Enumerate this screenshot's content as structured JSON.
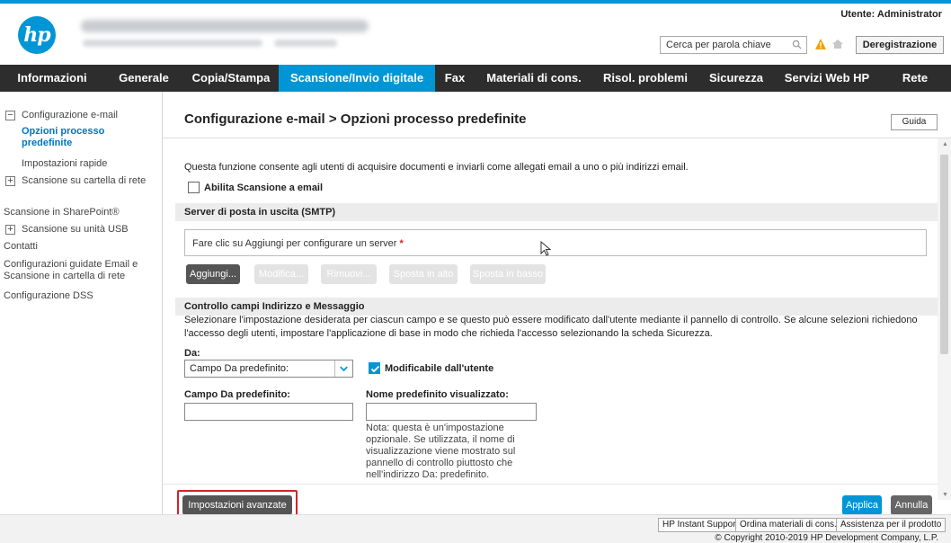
{
  "header": {
    "user_label": "Utente: Administrator",
    "search_placeholder": "Cerca per parola chiave",
    "logout_label": "Deregistrazione"
  },
  "nav": {
    "items": [
      {
        "label": "Informazioni"
      },
      {
        "label": "Generale"
      },
      {
        "label": "Copia/Stampa"
      },
      {
        "label": "Scansione/Invio digitale",
        "active": true
      },
      {
        "label": "Fax"
      },
      {
        "label": "Materiali di cons."
      },
      {
        "label": "Risol. problemi"
      },
      {
        "label": "Sicurezza"
      },
      {
        "label": "Servizi Web HP"
      },
      {
        "label": "Rete"
      }
    ]
  },
  "sidebar": {
    "items": [
      {
        "label": "Configurazione e-mail"
      },
      {
        "label": "Opzioni processo predefinite"
      },
      {
        "label": "Impostazioni rapide"
      },
      {
        "label": "Scansione su cartella di rete"
      },
      {
        "label": "Scansione in SharePoint®"
      },
      {
        "label": "Scansione su unità USB"
      },
      {
        "label": "Contatti"
      },
      {
        "label": "Configurazioni guidate Email e Scansione in cartella di rete"
      },
      {
        "label": "Configurazione DSS"
      }
    ]
  },
  "main": {
    "title": "Configurazione e-mail > Opzioni processo predefinite",
    "help_label": "Guida",
    "intro": "Questa funzione consente agli utenti di acquisire documenti e inviarli come allegati email a uno o più indirizzi email.",
    "enable_scan_label": "Abilita Scansione a email",
    "smtp_section": "Server di posta in uscita (SMTP)",
    "server_placeholder": "Fare clic su Aggiungi per configurare un server",
    "required_mark": "*",
    "buttons": {
      "add": "Aggiungi...",
      "edit": "Modifica...",
      "remove": "Rimuovi...",
      "move_up": "Sposta in alto",
      "move_down": "Sposta in basso"
    },
    "fields_section": "Controllo campi Indirizzo e Messaggio",
    "fields_desc": "Selezionare l'impostazione desiderata per ciascun campo e se questo può essere modificato dall'utente mediante il pannello di controllo. Se alcune selezioni richiedono l'accesso degli utenti, impostare l'applicazione di base in modo che richieda l'accesso selezionando la scheda Sicurezza.",
    "from_label": "Da:",
    "from_select_value": "Campo Da predefinito:",
    "user_editable_label": "Modificabile dall'utente",
    "default_from_label": "Campo Da predefinito:",
    "display_name_label": "Nome predefinito visualizzato:",
    "note": "Nota: questa è un'impostazione opzionale. Se utilizzata, il nome di visualizzazione viene mostrato sul pannello di controllo piuttosto che nell'indirizzo Da: predefinito.",
    "advanced_label": "Impostazioni avanzate",
    "apply_label": "Applica",
    "cancel_label": "Annulla"
  },
  "footer": {
    "links": [
      "HP Instant Support",
      "Ordina materiali di cons...",
      "Assistenza per il prodotto"
    ],
    "copyright": "© Copyright 2010-2019 HP Development Company, L.P."
  },
  "colors": {
    "accent": "#0096d6",
    "nav_bg": "#2d2d2d",
    "highlight": "#d2232a",
    "link": "#0076c0"
  }
}
